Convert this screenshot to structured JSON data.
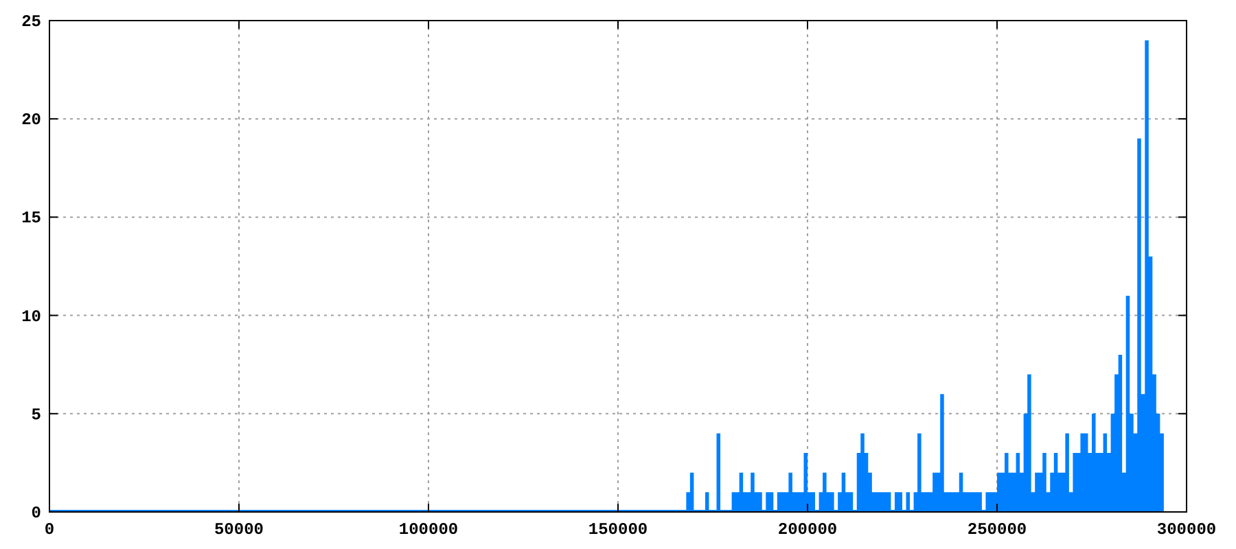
{
  "chart_data": {
    "type": "area",
    "grid": true,
    "xlim": [
      0,
      300000
    ],
    "ylim": [
      0,
      25
    ],
    "xticks": [
      0,
      50000,
      100000,
      150000,
      200000,
      250000,
      300000
    ],
    "yticks": [
      0,
      5,
      10,
      15,
      20,
      25
    ],
    "x": [
      0,
      168000,
      169000,
      170000,
      171000,
      172000,
      173000,
      174000,
      175000,
      176000,
      177000,
      178000,
      179000,
      180000,
      181000,
      182000,
      183000,
      184000,
      185000,
      186000,
      187000,
      188000,
      189000,
      190000,
      191000,
      192000,
      193000,
      194000,
      195000,
      196000,
      197000,
      198000,
      199000,
      200000,
      201000,
      202000,
      203000,
      204000,
      205000,
      206000,
      207000,
      208000,
      209000,
      210000,
      211000,
      212000,
      213000,
      214000,
      215000,
      216000,
      217000,
      218000,
      219000,
      220000,
      221000,
      222000,
      223000,
      224000,
      225000,
      226000,
      227000,
      228000,
      229000,
      230000,
      231000,
      232000,
      233000,
      234000,
      235000,
      236000,
      237000,
      238000,
      239000,
      240000,
      241000,
      242000,
      243000,
      244000,
      245000,
      246000,
      247000,
      248000,
      249000,
      250000,
      251000,
      252000,
      253000,
      254000,
      255000,
      256000,
      257000,
      258000,
      259000,
      260000,
      261000,
      262000,
      263000,
      264000,
      265000,
      266000,
      267000,
      268000,
      269000,
      270000,
      271000,
      272000,
      273000,
      274000,
      275000,
      276000,
      277000,
      278000,
      279000,
      280000,
      281000,
      282000,
      283000,
      284000,
      285000,
      286000,
      287000,
      288000,
      289000,
      290000,
      291000,
      292000,
      293000
    ],
    "series": [
      {
        "color": "#0080ff",
        "values": [
          0,
          1,
          2,
          0,
          0,
          0,
          1,
          0,
          0,
          4,
          0,
          0,
          0,
          1,
          1,
          2,
          1,
          1,
          2,
          1,
          1,
          0,
          1,
          1,
          0,
          1,
          1,
          1,
          2,
          1,
          1,
          1,
          3,
          1,
          1,
          0,
          1,
          2,
          1,
          1,
          0,
          1,
          2,
          1,
          1,
          0,
          3,
          4,
          3,
          2,
          1,
          1,
          1,
          1,
          1,
          0,
          1,
          1,
          0,
          1,
          0,
          1,
          4,
          1,
          1,
          1,
          2,
          2,
          6,
          1,
          1,
          1,
          1,
          2,
          1,
          1,
          1,
          1,
          1,
          0,
          1,
          1,
          1,
          2,
          2,
          3,
          2,
          2,
          3,
          2,
          5,
          7,
          1,
          2,
          2,
          3,
          1,
          2,
          3,
          2,
          2,
          4,
          1,
          3,
          3,
          4,
          4,
          3,
          5,
          3,
          3,
          4,
          3,
          5,
          7,
          8,
          2,
          11,
          5,
          4,
          19,
          6,
          24,
          13,
          7,
          5,
          4
        ]
      }
    ]
  }
}
